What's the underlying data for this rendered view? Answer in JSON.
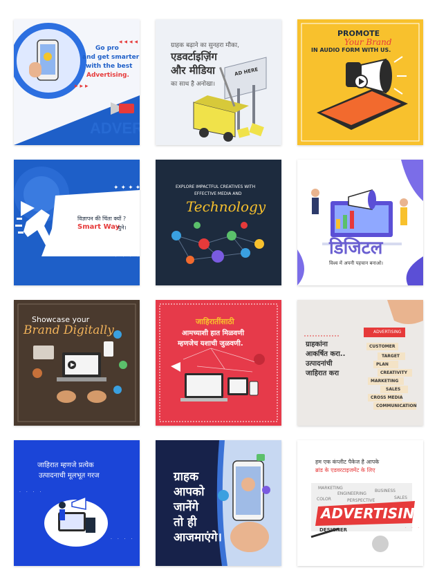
{
  "colors": {
    "blue": "#1e5fc8",
    "red": "#e63a3a",
    "navy": "#1d2b3e",
    "yellow": "#f8c12d",
    "lavender": "#eef1ff",
    "purple": "#5b4fd6",
    "brown": "#4a3a2e",
    "gray": "#ece9e6",
    "deepblue": "#1b45d8",
    "darknavy": "#17224a"
  },
  "tiles": [
    {
      "name": "go-pro-advertising",
      "lines": [
        "Go pro",
        "and get smarter",
        "with the best",
        "Advertising."
      ],
      "watermark": "ADVERTISING"
    },
    {
      "name": "hindi-advertising-media",
      "lines": [
        "ग्राहक बढ़ाने का सुनहरा मौका,",
        "एडवर्टाइज़िंग",
        "और मीडिया",
        "का साथ है अनोखा।"
      ],
      "billboard_text": "AD HERE"
    },
    {
      "name": "audio-promote",
      "lines": [
        "PROMOTE",
        "Your Brand",
        "IN AUDIO FORM WITH US."
      ]
    },
    {
      "name": "smart-way",
      "lines": [
        "विज्ञापन की चिंता क्यों ?",
        "Smart Way",
        "चुने।"
      ]
    },
    {
      "name": "technology",
      "lines": [
        "EXPLORE IMPACTFUL CREATIVES WITH",
        "EFFECTIVE MEDIA AND",
        "Technology"
      ]
    },
    {
      "name": "digital",
      "lines": [
        "डिजिटल",
        "विश्व में अपनी पहचान बनाओ।"
      ]
    },
    {
      "name": "brand-digitally",
      "lines": [
        "Showcase your",
        "Brand Digitally"
      ]
    },
    {
      "name": "marathi-advertising",
      "lines": [
        "जाहिरातींसाठी",
        "आमच्याशी हात मिळवणी",
        "म्हणजेच यशाची जुळवणी."
      ]
    },
    {
      "name": "advertising-blocks",
      "lines": [
        "ग्राहकांना",
        "आकर्षित करा..",
        "उत्पादनांची",
        "जाहिरात करा"
      ],
      "blocks": [
        "ADVERTISING",
        "CUSTOMER",
        "TARGET",
        "PLAN",
        "CREATIVITY",
        "MARKETING",
        "SALES",
        "CROSS MEDIA",
        "COMMUNICATION"
      ]
    },
    {
      "name": "product-need",
      "lines": [
        "जाहिरात म्हणजे प्रत्येक",
        "उत्पादनाची मूलभूत गरज"
      ]
    },
    {
      "name": "customer-find",
      "lines": [
        "ग्राहक",
        "आपको",
        "जानेंगे",
        "तो ही",
        "आजमाएंगे।"
      ]
    },
    {
      "name": "complete-package",
      "lines": [
        "हम एक कंप्लीट पैकेज है आपके",
        "ब्रांड के एडवरटाइजमेंट के लिए"
      ],
      "title": "ADVERTISING",
      "collage": [
        "MARKETING",
        "BUSINESS",
        "SALES",
        "DESIGNER",
        "ENGINEERING",
        "COLOR",
        "PERSPECTIVE"
      ]
    }
  ]
}
